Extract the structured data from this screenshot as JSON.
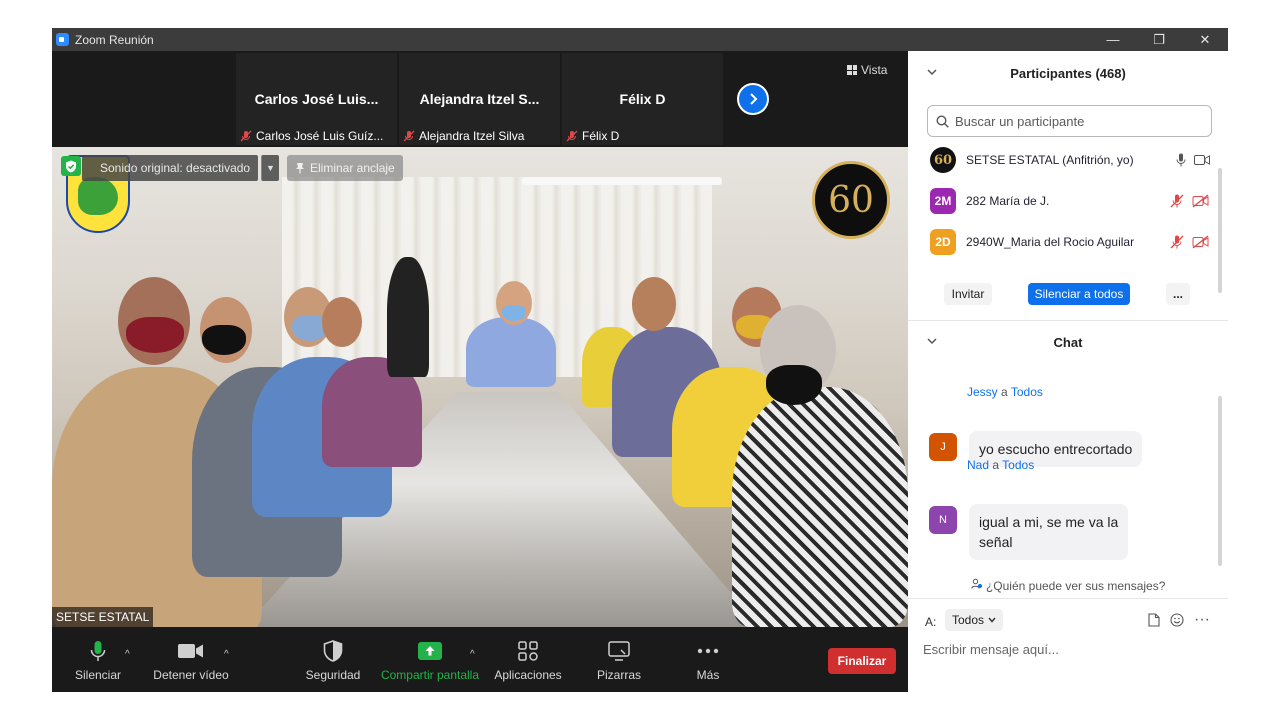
{
  "window": {
    "title": "Zoom Reunión",
    "controls": {
      "minimize": "—",
      "restore": "❐",
      "close": "✕"
    }
  },
  "gallery": {
    "tiles": [
      {
        "name": "Carlos José Luis...",
        "label": "Carlos José Luis Guíz..."
      },
      {
        "name": "Alejandra  Itzel S...",
        "label": "Alejandra Itzel Silva"
      },
      {
        "name": "Félix D",
        "label": "Félix D"
      }
    ],
    "view_label": "Vista"
  },
  "main_video": {
    "original_sound": "Sonido original: desactivado",
    "unpin": "Eliminar anclaje",
    "speaker": "SETSE ESTATAL",
    "anniversary_text": "60"
  },
  "toolbar": {
    "mute": "Silenciar",
    "stop_video": "Detener vídeo",
    "security": "Seguridad",
    "share": "Compartir pantalla",
    "apps": "Aplicaciones",
    "whiteboards": "Pizarras",
    "more": "Más",
    "end": "Finalizar"
  },
  "participants": {
    "header": "Participantes (468)",
    "search_placeholder": "Buscar un participante",
    "list": [
      {
        "initials": "60",
        "name": "SETSE ESTATAL (Anfitrión, yo)",
        "color": "#111111"
      },
      {
        "initials": "2M",
        "name": "282 María de J.",
        "color": "#9c27b0"
      },
      {
        "initials": "2D",
        "name": "2940W_Maria del Rocio Aguilar",
        "color": "#f0a020"
      }
    ],
    "invite": "Invitar",
    "mute_all": "Silenciar a todos",
    "more": "..."
  },
  "chat": {
    "header": "Chat",
    "messages": [
      {
        "sender": "Jessy",
        "to_word": "a",
        "recipient": "Todos",
        "initial": "J",
        "color": "#d35400",
        "text": "yo escucho entrecortado"
      },
      {
        "sender": "Nad",
        "to_word": "a",
        "recipient": "Todos",
        "initial": "N",
        "color": "#8e44ad",
        "text_line1": "igual a mi, se me va la",
        "text_line2": "señal"
      }
    ],
    "who_can_see": "¿Quién puede ver sus mensajes?",
    "to_label": "A:",
    "recipient_value": "Todos",
    "input_placeholder": "Escribir mensaje aquí...",
    "more_tools": "···"
  },
  "colors": {
    "accent_blue": "#0e71eb",
    "end_red": "#d02f2f",
    "share_green": "#24b24a",
    "mic_green": "#24b24a"
  }
}
